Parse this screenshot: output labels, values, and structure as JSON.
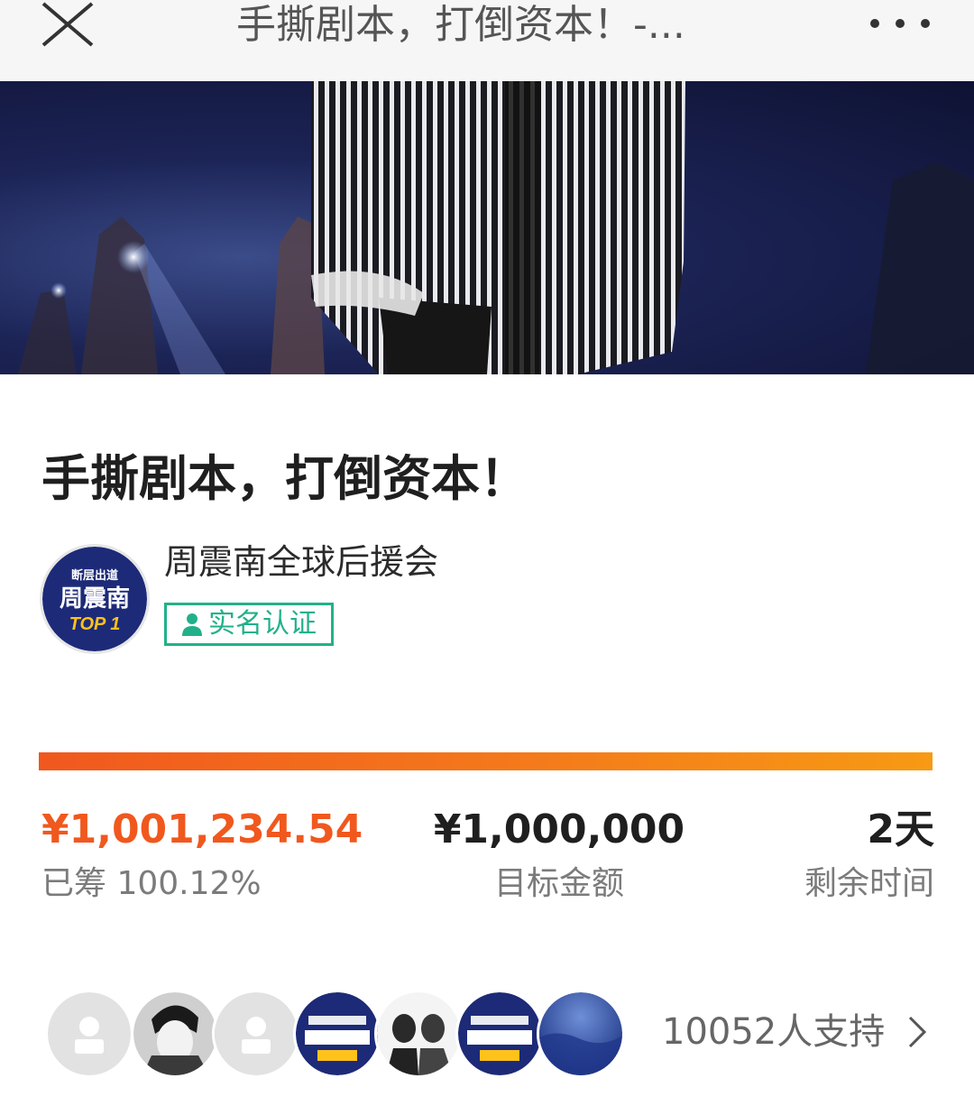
{
  "topbar": {
    "title": "手撕剧本，打倒资本！-...",
    "close_icon": "close-icon",
    "more_icon": "more-dots-icon"
  },
  "hero": {
    "image": "concert-performer-photo"
  },
  "campaign": {
    "title": "手撕剧本，打倒资本！"
  },
  "organizer": {
    "name": "周震南全球后援会",
    "avatar_lines": [
      "断层出道",
      "周震南",
      "TOP 1"
    ],
    "verified_label": "实名认证",
    "verified_icon": "person-icon"
  },
  "progress": {
    "percent": 100.12
  },
  "stats": {
    "raised_amount": "¥1,001,234.54",
    "raised_label": "已筹 100.12%",
    "goal_amount": "¥1,000,000",
    "goal_label": "目标金额",
    "days_left": "2天",
    "days_label": "剩余时间"
  },
  "supporters": {
    "count_label": "10052人支持",
    "chevron_icon": "chevron-right-icon",
    "avatars": [
      "default",
      "photo-bw",
      "default",
      "logo",
      "photo-duo",
      "logo",
      "blue-texture"
    ]
  },
  "colors": {
    "accent_orange": "#f0581e",
    "verified_green": "#22b08a"
  }
}
